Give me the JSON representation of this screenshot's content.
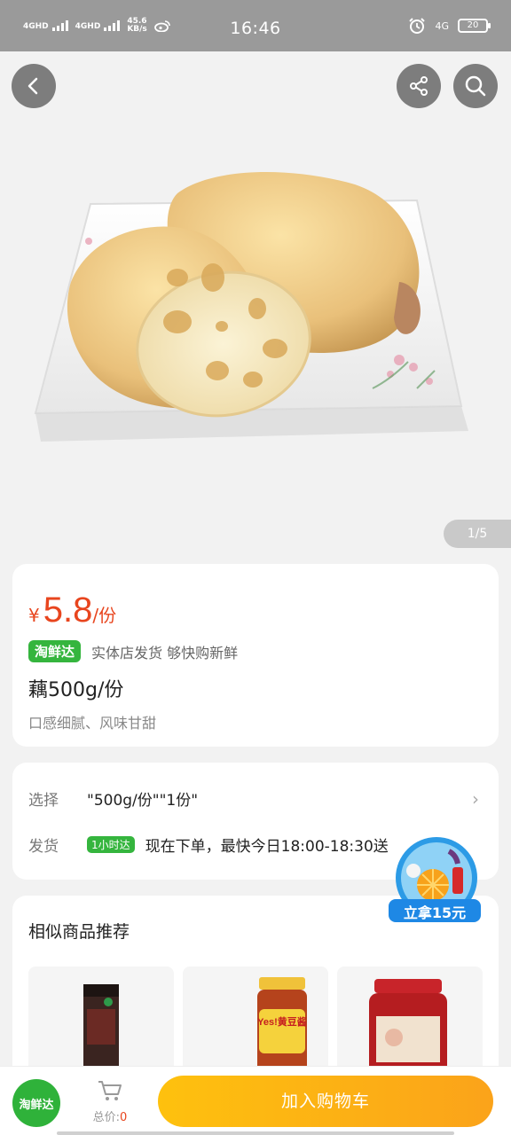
{
  "status_bar": {
    "network_1": "4GHD",
    "network_2": "4GHD",
    "speed_value": "45.6",
    "speed_unit": "KB/s",
    "time": "16:46",
    "network_right": "4G",
    "battery": "20"
  },
  "hero": {
    "image_counter": "1/5",
    "image_alt": "莲藕"
  },
  "product": {
    "currency": "¥",
    "price": "5.8",
    "price_unit": "/份",
    "service_tag": "淘鲜达",
    "service_desc": "实体店发货 够快购新鲜",
    "name": "藕500g/份",
    "subtitle": "口感细腻、风味甘甜"
  },
  "options": {
    "select_label": "选择",
    "select_value": "\"500g/份\"\"1份\"",
    "ship_label": "发货",
    "ship_tag": "1小时达",
    "ship_value": "现在下单，最快今日18:00-18:30送"
  },
  "promo": {
    "label": "立拿15元"
  },
  "recommend": {
    "title": "相似商品推荐",
    "items": [
      {
        "label": ""
      },
      {
        "label": "Yes!黄豆酱"
      },
      {
        "label": ""
      }
    ]
  },
  "bottom_bar": {
    "logo_label": "淘鲜达",
    "total_label": "总价:",
    "total_value": "0",
    "add_to_cart": "加入购物车"
  }
}
